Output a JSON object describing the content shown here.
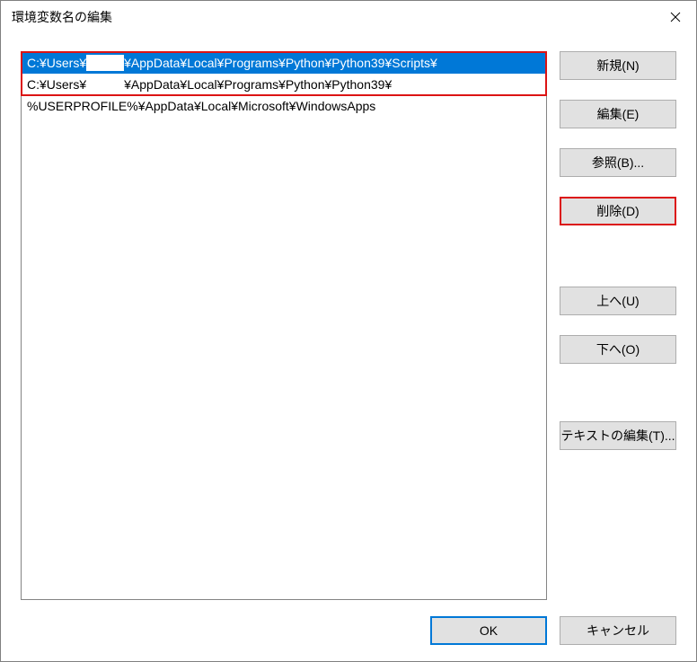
{
  "window": {
    "title": "環境変数名の編集"
  },
  "list": {
    "items": [
      {
        "prefix": "C:¥Users¥",
        "suffix": "¥AppData¥Local¥Programs¥Python¥Python39¥Scripts¥",
        "selected": true,
        "redacted": true
      },
      {
        "prefix": "C:¥Users¥",
        "suffix": "¥AppData¥Local¥Programs¥Python¥Python39¥",
        "selected": false,
        "redacted": true
      },
      {
        "prefix": "%USERPROFILE%¥AppData¥Local¥Microsoft¥WindowsApps",
        "suffix": "",
        "selected": false,
        "redacted": false
      }
    ]
  },
  "buttons": {
    "new": "新規(N)",
    "edit": "編集(E)",
    "browse": "参照(B)...",
    "delete": "削除(D)",
    "up": "上へ(U)",
    "down": "下へ(O)",
    "edit_text": "テキストの編集(T)...",
    "ok": "OK",
    "cancel": "キャンセル"
  }
}
